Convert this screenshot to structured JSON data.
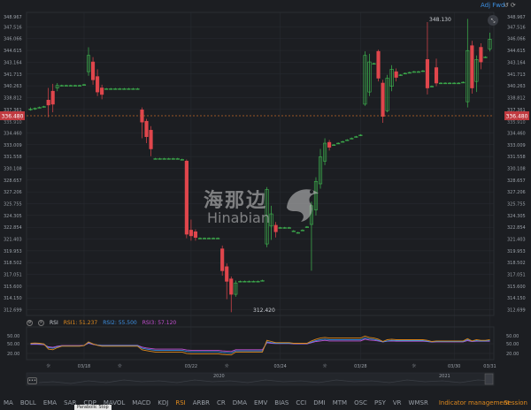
{
  "toolbar": {
    "adj_label": "Adj Fwd",
    "icons": [
      "reset-icon",
      "refresh-icon"
    ]
  },
  "price_axis": {
    "ticks": [
      "347.516",
      "346.066",
      "344.615",
      "343.164",
      "341.713",
      "340.263",
      "338.812",
      "337.361",
      "334.460",
      "333.009",
      "331.558",
      "330.108",
      "328.657",
      "327.206",
      "325.755",
      "324.305",
      "322.854",
      "321.403",
      "319.953",
      "318.502",
      "317.051",
      "315.600",
      "314.150",
      "312.699"
    ],
    "top_partial": "348.967",
    "current_price": "336.480",
    "current_price_under": "335.910",
    "current_color": "#e0464c"
  },
  "annotations": {
    "high": "348.130",
    "low": "312.420"
  },
  "watermark": {
    "cn": "海那边",
    "en": "Hinabian"
  },
  "rsi": {
    "label": "RSI",
    "rsi1": "RSI1: 51.237",
    "rsi2": "RSI2: 55.500",
    "rsi3": "RSI3: 57.120",
    "colors": {
      "rsi1": "#e08a1e",
      "rsi2": "#3d8fe0",
      "rsi3": "#c44fd0"
    },
    "ticks": [
      "50.00",
      "20.00"
    ],
    "right_ticks": [
      "50.00",
      "20.00"
    ]
  },
  "dates": [
    "03/18",
    "03/22",
    "03/24",
    "03/28",
    "03/30",
    "03/31"
  ],
  "navigator": {
    "years": [
      "2020",
      "2021"
    ]
  },
  "indicators": [
    "MA",
    "BOLL",
    "EMA",
    "SAR",
    "CDP",
    "MAVOL",
    "MACD",
    "KDJ",
    "RSI",
    "ARBR",
    "CR",
    "DMA",
    "EMV",
    "BIAS",
    "CCI",
    "DMI",
    "MTM",
    "OSC",
    "PSY",
    "VR",
    "WMSR"
  ],
  "active_indicator": "RSI",
  "indicator_management": "Indicator management",
  "session": "Session",
  "tooltip": "Parabolic Stop",
  "colors": {
    "up": "#3fb950",
    "down": "#e0464c",
    "grid": "#2a2d33"
  },
  "chart_data": {
    "type": "candlestick",
    "ylim": [
      312.0,
      349.3
    ],
    "candles": [
      {
        "o": 337.4,
        "c": 337.4,
        "h": 337.6,
        "l": 337.2
      },
      {
        "o": 337.5,
        "c": 337.5,
        "h": 337.6,
        "l": 337.3
      },
      {
        "o": 337.6,
        "c": 337.6,
        "h": 337.7,
        "l": 337.5
      },
      {
        "o": 337.7,
        "c": 337.7,
        "h": 337.8,
        "l": 337.6
      },
      {
        "o": 338.5,
        "c": 337.9,
        "h": 340.0,
        "l": 336.4
      },
      {
        "o": 339.6,
        "c": 338.0,
        "h": 340.5,
        "l": 337.0
      },
      {
        "o": 340.0,
        "c": 340.3,
        "h": 340.6,
        "l": 339.6
      },
      {
        "o": 340.3,
        "c": 340.3,
        "h": 340.4,
        "l": 340.2
      },
      {
        "o": 340.3,
        "c": 340.3,
        "h": 340.4,
        "l": 340.2
      },
      {
        "o": 340.3,
        "c": 340.3,
        "h": 340.4,
        "l": 340.2
      },
      {
        "o": 340.3,
        "c": 340.3,
        "h": 340.4,
        "l": 340.2
      },
      {
        "o": 340.3,
        "c": 340.3,
        "h": 340.4,
        "l": 340.2
      },
      {
        "o": 340.4,
        "c": 340.4,
        "h": 340.5,
        "l": 340.3
      },
      {
        "o": 342.0,
        "c": 344.0,
        "h": 345.0,
        "l": 341.5
      },
      {
        "o": 343.2,
        "c": 341.0,
        "h": 343.8,
        "l": 340.4
      },
      {
        "o": 341.4,
        "c": 339.5,
        "h": 342.3,
        "l": 339.0
      },
      {
        "o": 340.0,
        "c": 339.2,
        "h": 340.4,
        "l": 338.6
      },
      {
        "o": 339.9,
        "c": 339.9,
        "h": 340.0,
        "l": 339.8
      },
      {
        "o": 339.9,
        "c": 339.9,
        "h": 340.0,
        "l": 339.8
      },
      {
        "o": 339.9,
        "c": 339.9,
        "h": 340.0,
        "l": 339.8
      },
      {
        "o": 339.9,
        "c": 339.9,
        "h": 340.0,
        "l": 339.8
      },
      {
        "o": 339.9,
        "c": 339.9,
        "h": 340.0,
        "l": 339.8
      },
      {
        "o": 339.9,
        "c": 339.9,
        "h": 340.0,
        "l": 339.8
      },
      {
        "o": 339.9,
        "c": 339.9,
        "h": 340.0,
        "l": 339.8
      },
      {
        "o": 339.9,
        "c": 339.9,
        "h": 340.0,
        "l": 339.8
      },
      {
        "o": 337.3,
        "c": 335.8,
        "h": 337.6,
        "l": 333.8
      },
      {
        "o": 335.9,
        "c": 334.0,
        "h": 336.2,
        "l": 333.2
      },
      {
        "o": 334.8,
        "c": 332.5,
        "h": 335.3,
        "l": 331.6
      },
      {
        "o": 331.3,
        "c": 331.3,
        "h": 331.4,
        "l": 331.2
      },
      {
        "o": 331.3,
        "c": 331.3,
        "h": 331.4,
        "l": 331.2
      },
      {
        "o": 331.3,
        "c": 331.3,
        "h": 331.4,
        "l": 331.2
      },
      {
        "o": 331.3,
        "c": 331.3,
        "h": 331.4,
        "l": 331.2
      },
      {
        "o": 331.3,
        "c": 331.3,
        "h": 331.4,
        "l": 331.2
      },
      {
        "o": 331.3,
        "c": 331.3,
        "h": 331.4,
        "l": 331.2
      },
      {
        "o": 331.2,
        "c": 331.2,
        "h": 331.3,
        "l": 331.1
      },
      {
        "o": 331.0,
        "c": 322.0,
        "h": 331.2,
        "l": 321.5
      },
      {
        "o": 322.5,
        "c": 321.8,
        "h": 323.8,
        "l": 321.2
      },
      {
        "o": 322.3,
        "c": 321.6,
        "h": 322.6,
        "l": 321.2
      },
      {
        "o": 321.5,
        "c": 321.5,
        "h": 321.6,
        "l": 321.4
      },
      {
        "o": 321.5,
        "c": 321.5,
        "h": 321.6,
        "l": 321.4
      },
      {
        "o": 321.5,
        "c": 321.5,
        "h": 321.6,
        "l": 321.4
      },
      {
        "o": 321.5,
        "c": 321.5,
        "h": 321.6,
        "l": 321.4
      },
      {
        "o": 321.5,
        "c": 321.5,
        "h": 321.6,
        "l": 321.4
      },
      {
        "o": 320.2,
        "c": 317.5,
        "h": 320.6,
        "l": 316.9
      },
      {
        "o": 318.0,
        "c": 316.2,
        "h": 318.4,
        "l": 314.0
      },
      {
        "o": 316.5,
        "c": 314.6,
        "h": 316.8,
        "l": 312.4
      },
      {
        "o": 314.6,
        "c": 316.0,
        "h": 316.3,
        "l": 314.3
      },
      {
        "o": 316.2,
        "c": 316.2,
        "h": 316.3,
        "l": 316.1
      },
      {
        "o": 316.2,
        "c": 316.2,
        "h": 316.3,
        "l": 316.1
      },
      {
        "o": 316.2,
        "c": 316.2,
        "h": 316.3,
        "l": 316.1
      },
      {
        "o": 316.2,
        "c": 316.2,
        "h": 316.3,
        "l": 316.1
      },
      {
        "o": 316.2,
        "c": 316.2,
        "h": 316.3,
        "l": 316.1
      },
      {
        "o": 316.3,
        "c": 316.3,
        "h": 316.4,
        "l": 316.2
      },
      {
        "o": 320.8,
        "c": 327.5,
        "h": 327.8,
        "l": 320.4
      },
      {
        "o": 323.0,
        "c": 324.5,
        "h": 325.5,
        "l": 321.3
      },
      {
        "o": 323.1,
        "c": 322.3,
        "h": 323.5,
        "l": 321.6
      },
      {
        "o": 322.8,
        "c": 322.8,
        "h": 322.9,
        "l": 322.7
      },
      {
        "o": 322.8,
        "c": 322.8,
        "h": 322.9,
        "l": 322.7
      },
      {
        "o": 322.8,
        "c": 322.8,
        "h": 322.9,
        "l": 322.7
      },
      {
        "o": 322.4,
        "c": 322.4,
        "h": 322.5,
        "l": 322.3
      },
      {
        "o": 322.2,
        "c": 322.2,
        "h": 322.3,
        "l": 322.1
      },
      {
        "o": 322.5,
        "c": 322.5,
        "h": 322.6,
        "l": 322.4
      },
      {
        "o": 322.9,
        "c": 322.9,
        "h": 323.0,
        "l": 322.8
      },
      {
        "o": 323.2,
        "c": 325.5,
        "h": 326.0,
        "l": 317.5
      },
      {
        "o": 325.0,
        "c": 328.5,
        "h": 329.0,
        "l": 324.3
      },
      {
        "o": 328.2,
        "c": 331.5,
        "h": 332.5,
        "l": 327.6
      },
      {
        "o": 331.0,
        "c": 333.2,
        "h": 333.8,
        "l": 330.5
      },
      {
        "o": 333.3,
        "c": 332.7,
        "h": 333.6,
        "l": 332.3
      },
      {
        "o": 333.0,
        "c": 333.0,
        "h": 333.1,
        "l": 332.9
      },
      {
        "o": 333.2,
        "c": 333.2,
        "h": 333.3,
        "l": 333.1
      },
      {
        "o": 333.4,
        "c": 333.4,
        "h": 333.5,
        "l": 333.3
      },
      {
        "o": 333.6,
        "c": 333.6,
        "h": 333.7,
        "l": 333.5
      },
      {
        "o": 333.8,
        "c": 333.8,
        "h": 333.9,
        "l": 333.7
      },
      {
        "o": 334.0,
        "c": 334.0,
        "h": 334.1,
        "l": 333.9
      },
      {
        "o": 334.2,
        "c": 334.2,
        "h": 334.3,
        "l": 334.1
      },
      {
        "o": 338.0,
        "c": 344.0,
        "h": 344.5,
        "l": 337.8
      },
      {
        "o": 339.5,
        "c": 343.2,
        "h": 344.2,
        "l": 339.0
      },
      {
        "o": 343.0,
        "c": 343.0,
        "h": 343.1,
        "l": 342.9
      },
      {
        "o": 344.5,
        "c": 341.2,
        "h": 344.7,
        "l": 340.8
      },
      {
        "o": 340.6,
        "c": 336.5,
        "h": 341.0,
        "l": 335.7
      },
      {
        "o": 337.2,
        "c": 341.2,
        "h": 341.6,
        "l": 337.0
      },
      {
        "o": 340.2,
        "c": 342.3,
        "h": 342.8,
        "l": 339.6
      },
      {
        "o": 342.0,
        "c": 341.3,
        "h": 342.4,
        "l": 340.8
      },
      {
        "o": 341.6,
        "c": 341.6,
        "h": 341.7,
        "l": 341.5
      },
      {
        "o": 341.8,
        "c": 341.8,
        "h": 341.9,
        "l": 341.7
      },
      {
        "o": 341.9,
        "c": 341.9,
        "h": 342.0,
        "l": 341.8
      },
      {
        "o": 342.0,
        "c": 342.0,
        "h": 342.1,
        "l": 341.9
      },
      {
        "o": 342.0,
        "c": 342.0,
        "h": 342.1,
        "l": 341.9
      },
      {
        "o": 342.1,
        "c": 342.1,
        "h": 342.2,
        "l": 342.0
      },
      {
        "o": 343.5,
        "c": 340.0,
        "h": 348.1,
        "l": 339.2
      },
      {
        "o": 340.2,
        "c": 340.2,
        "h": 340.3,
        "l": 340.1
      },
      {
        "o": 342.5,
        "c": 340.6,
        "h": 343.6,
        "l": 340.2
      },
      {
        "o": 340.6,
        "c": 340.6,
        "h": 340.7,
        "l": 340.5
      },
      {
        "o": 340.6,
        "c": 340.6,
        "h": 340.7,
        "l": 340.5
      },
      {
        "o": 340.6,
        "c": 340.6,
        "h": 340.7,
        "l": 340.5
      },
      {
        "o": 340.6,
        "c": 340.6,
        "h": 340.7,
        "l": 340.5
      },
      {
        "o": 340.6,
        "c": 340.6,
        "h": 340.7,
        "l": 340.5
      },
      {
        "o": 340.7,
        "c": 340.7,
        "h": 340.8,
        "l": 340.6
      },
      {
        "o": 338.3,
        "c": 344.6,
        "h": 348.5,
        "l": 337.6
      },
      {
        "o": 345.2,
        "c": 340.0,
        "h": 345.8,
        "l": 339.3
      },
      {
        "o": 340.8,
        "c": 343.5,
        "h": 344.0,
        "l": 339.5
      },
      {
        "o": 345.0,
        "c": 343.2,
        "h": 345.5,
        "l": 342.3
      },
      {
        "o": 343.8,
        "c": 343.8,
        "h": 343.9,
        "l": 343.7
      },
      {
        "o": 344.8,
        "c": 346.0,
        "h": 346.8,
        "l": 344.5
      }
    ],
    "rsi": {
      "ylim": [
        0,
        100
      ],
      "rsi1": [
        50,
        51,
        50,
        48,
        30,
        28,
        35,
        40,
        40,
        40,
        40,
        40,
        42,
        55,
        48,
        43,
        40,
        40,
        40,
        40,
        40,
        40,
        40,
        40,
        40,
        28,
        25,
        22,
        20,
        20,
        20,
        20,
        20,
        20,
        20,
        15,
        14,
        14,
        14,
        14,
        14,
        14,
        14,
        12,
        11,
        10,
        20,
        20,
        20,
        20,
        20,
        20,
        20,
        60,
        56,
        52,
        52,
        52,
        52,
        50,
        50,
        50,
        50,
        58,
        64,
        68,
        70,
        68,
        68,
        68,
        68,
        68,
        68,
        68,
        68,
        75,
        70,
        68,
        64,
        56,
        62,
        64,
        62,
        62,
        62,
        62,
        62,
        62,
        62,
        60,
        56,
        58,
        58,
        58,
        58,
        58,
        58,
        58,
        66,
        58,
        62,
        60,
        60,
        62
      ],
      "rsi2": [
        48,
        49,
        48,
        47,
        35,
        33,
        38,
        41,
        41,
        41,
        41,
        41,
        42,
        52,
        47,
        44,
        42,
        42,
        42,
        42,
        42,
        42,
        42,
        42,
        42,
        33,
        30,
        28,
        26,
        26,
        26,
        26,
        26,
        26,
        26,
        22,
        21,
        21,
        21,
        21,
        21,
        21,
        21,
        19,
        18,
        17,
        24,
        24,
        24,
        24,
        24,
        24,
        24,
        55,
        52,
        50,
        50,
        50,
        50,
        49,
        49,
        49,
        49,
        54,
        59,
        62,
        64,
        62,
        62,
        62,
        62,
        62,
        62,
        62,
        62,
        68,
        65,
        63,
        60,
        55,
        58,
        60,
        59,
        59,
        59,
        59,
        59,
        59,
        59,
        57,
        55,
        56,
        56,
        56,
        56,
        56,
        56,
        56,
        62,
        57,
        59,
        58,
        58,
        59
      ],
      "rsi3": [
        46,
        47,
        46,
        45,
        38,
        36,
        40,
        42,
        42,
        42,
        42,
        42,
        43,
        50,
        46,
        44,
        43,
        43,
        43,
        43,
        43,
        43,
        43,
        43,
        43,
        37,
        34,
        32,
        30,
        30,
        30,
        30,
        30,
        30,
        30,
        27,
        26,
        26,
        26,
        26,
        26,
        26,
        26,
        24,
        23,
        22,
        28,
        28,
        28,
        28,
        28,
        28,
        28,
        52,
        50,
        49,
        49,
        49,
        49,
        48,
        48,
        48,
        48,
        52,
        56,
        58,
        60,
        58,
        58,
        58,
        58,
        58,
        58,
        58,
        58,
        64,
        61,
        60,
        58,
        55,
        57,
        58,
        57,
        57,
        57,
        57,
        57,
        57,
        57,
        56,
        54,
        55,
        55,
        55,
        55,
        55,
        55,
        55,
        59,
        56,
        57,
        57,
        57,
        57
      ]
    },
    "xlabels": [
      "03/18",
      "03/22",
      "03/24",
      "03/28",
      "03/30",
      "03/31"
    ]
  }
}
